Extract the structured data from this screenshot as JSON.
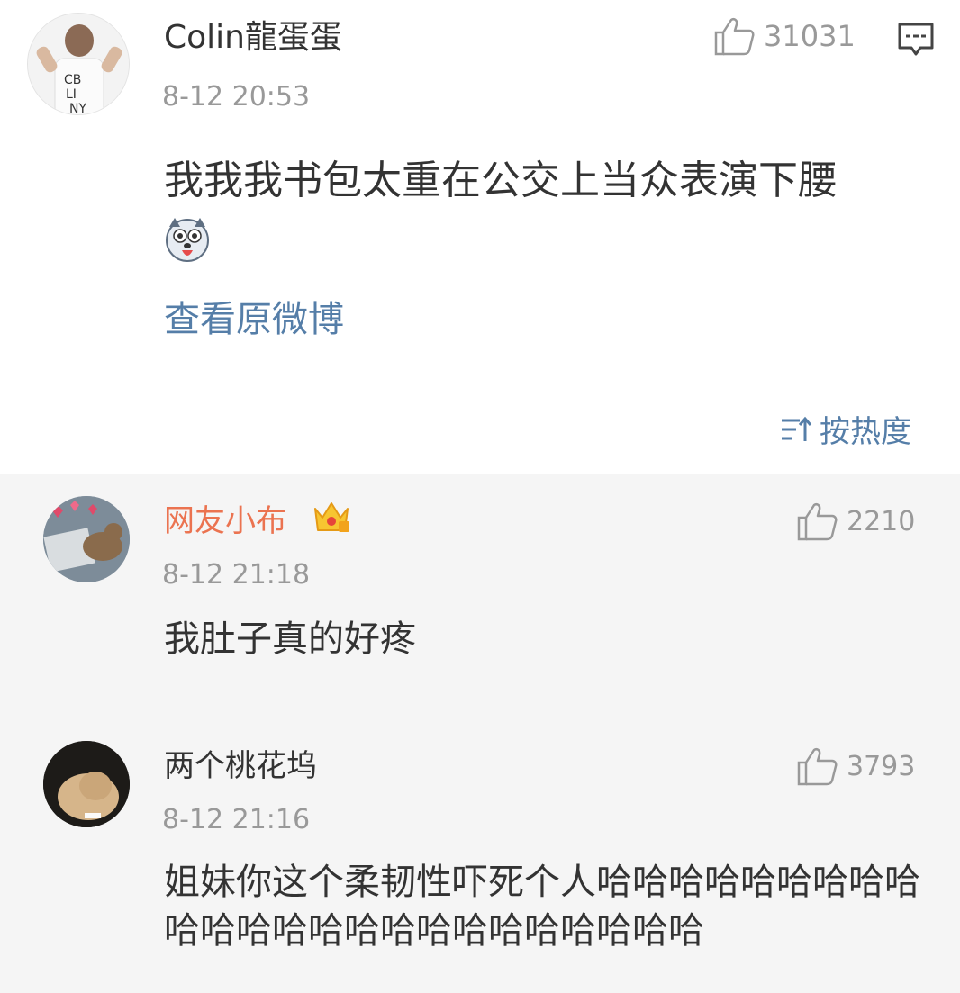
{
  "post": {
    "author": "Colin龍蛋蛋",
    "time": "8-12 20:53",
    "likes": "31031",
    "text": "我我我书包太重在公交上当众表演下腰",
    "emoji": "husky-emoji",
    "view_original": "查看原微博",
    "sort_label": "按热度"
  },
  "replies": [
    {
      "author": "网友小布",
      "badge": "crown-vip-icon",
      "time": "8-12 21:18",
      "likes": "2210",
      "text": "我肚子真的好疼"
    },
    {
      "author": "两个桃花坞",
      "time": "8-12 21:16",
      "likes": "3793",
      "text": "姐妹你这个柔韧性吓死个人哈哈哈哈哈哈哈哈哈哈哈哈哈哈哈哈哈哈哈哈哈哈哈哈"
    }
  ],
  "colors": {
    "link": "#557ea8",
    "vip_name": "#eb7350",
    "meta": "#999999",
    "reply_bg": "#f5f5f5"
  }
}
